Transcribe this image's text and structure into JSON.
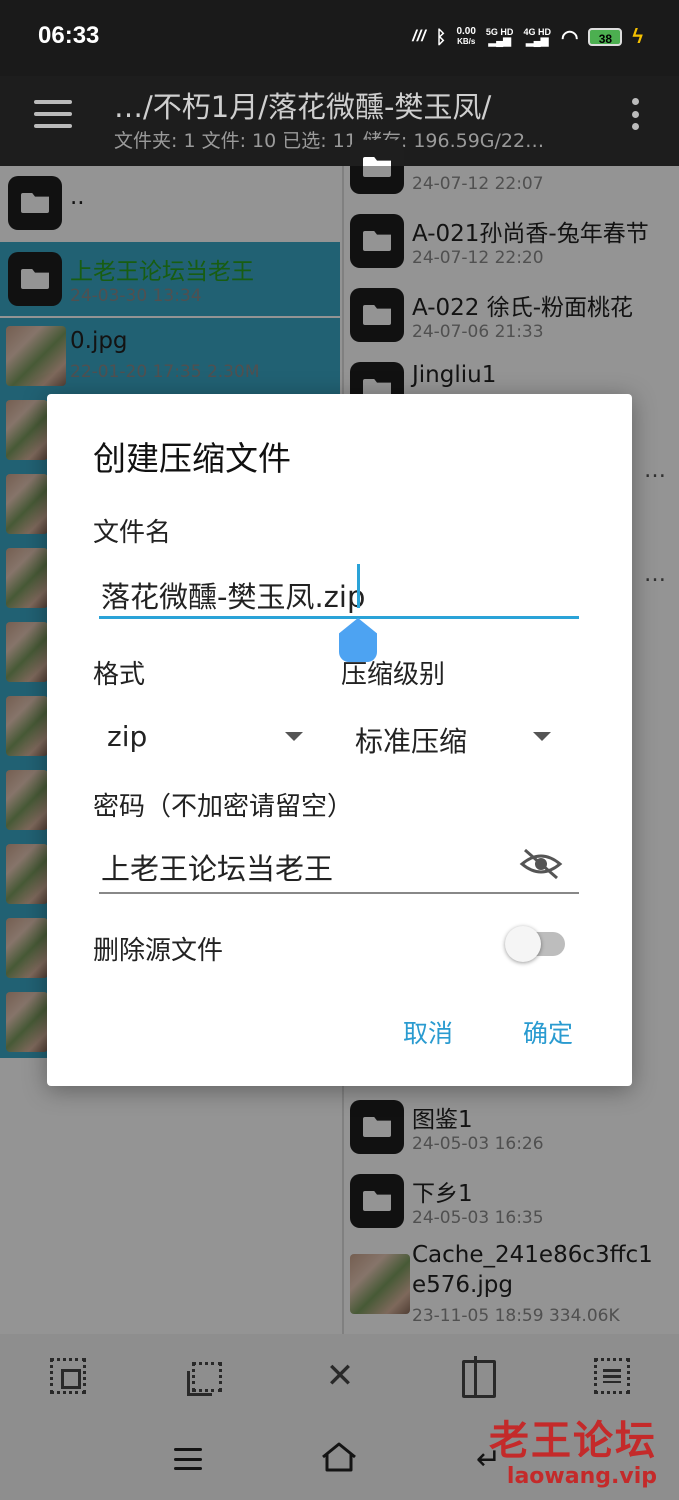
{
  "status_bar": {
    "time": "06:33",
    "network_speed_value": "0.00",
    "network_speed_unit": "KB/s",
    "sim1": "5G HD",
    "sim2": "4G HD",
    "battery": "38"
  },
  "app_bar": {
    "path": "…/不朽1月/落花微醺-樊玉凤/",
    "info": "文件夹: 1  文件: 10  已选: 11  储存: 196.59G/22…"
  },
  "left_pane": {
    "items": [
      {
        "name": "..",
        "meta": "",
        "type": "folder"
      },
      {
        "name": "上老王论坛当老王",
        "meta": "24-03-30 13:34",
        "type": "folder",
        "selected": true
      },
      {
        "name": "0.jpg",
        "meta": "22-01-20 17:35  2.30M",
        "type": "image",
        "selected": true
      }
    ]
  },
  "right_pane": {
    "items": [
      {
        "name": "",
        "meta": "24-07-12 22:07"
      },
      {
        "name": "A-021孙尚香-兔年春节",
        "meta": "24-07-12 22:20"
      },
      {
        "name": "A-022 徐氏-粉面桃花",
        "meta": "24-07-06 21:33"
      },
      {
        "name": "Jingliu1",
        "meta": ""
      },
      {
        "name": "图鉴1",
        "meta": "24-05-03 16:26"
      },
      {
        "name": "下乡1",
        "meta": "24-05-03 16:35"
      },
      {
        "name": "Cache_241e86c3ffc1",
        "name2": "e576.jpg",
        "meta": "23-11-05 18:59  334.06K"
      }
    ],
    "partial_text_1": "…",
    "partial_text_2": "…"
  },
  "dialog": {
    "title": "创建压缩文件",
    "filename_label": "文件名",
    "filename_value_base": "落花微醺-樊玉凤",
    "filename_value_ext": ".zip",
    "format_label": "格式",
    "format_value": "zip",
    "level_label": "压缩级别",
    "level_value": "标准压缩",
    "password_label": "密码（不加密请留空）",
    "password_value": "上老王论坛当老王",
    "delete_source_label": "删除源文件",
    "delete_source_on": false,
    "cancel": "取消",
    "confirm": "确定"
  },
  "watermark": {
    "main": "老王论坛",
    "sub": "laowang.vip"
  },
  "colors": {
    "accent": "#2aa3d8",
    "selection": "#3aa7c7",
    "green_text": "#2aa01f",
    "watermark": "#c42a2a"
  }
}
